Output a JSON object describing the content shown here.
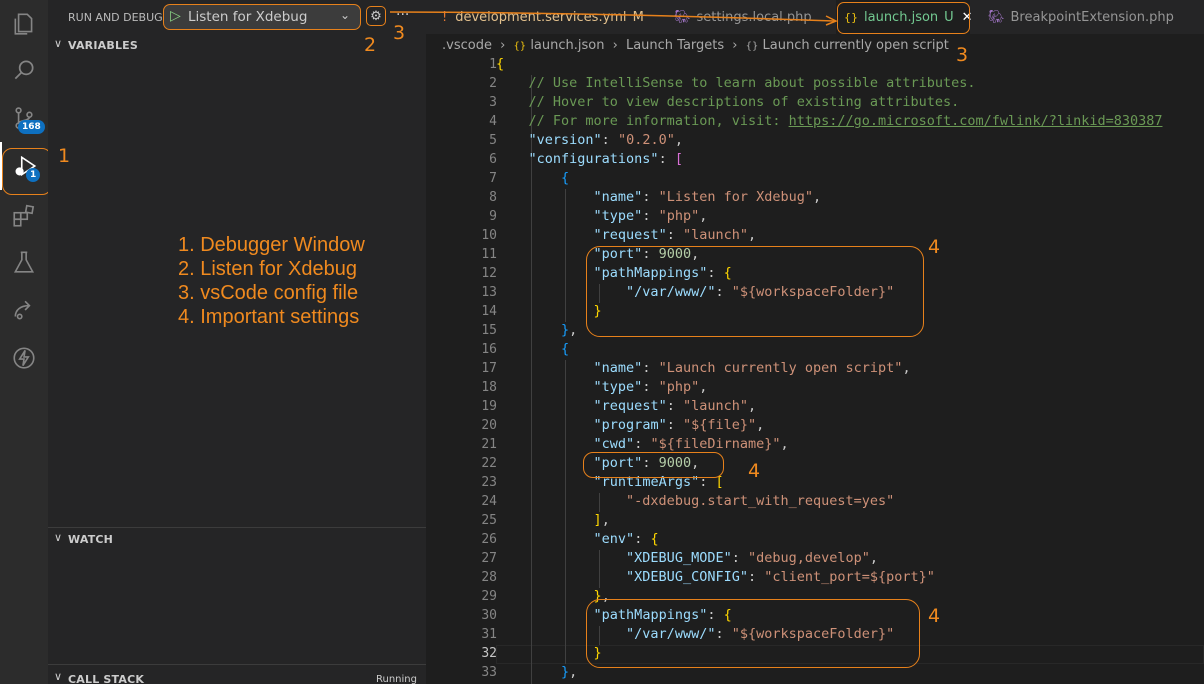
{
  "activity_bar": {
    "items": [
      {
        "name": "explorer-icon"
      },
      {
        "name": "search-icon"
      },
      {
        "name": "source-control-icon",
        "badge": "168"
      },
      {
        "name": "run-debug-icon",
        "badge": "1"
      },
      {
        "name": "extensions-icon"
      },
      {
        "name": "testing-icon"
      },
      {
        "name": "remote-explorer-icon"
      },
      {
        "name": "lightning-icon"
      }
    ]
  },
  "sidebar": {
    "title": "RUN AND DEBUG",
    "config_selected": "Listen for Xdebug",
    "sections": {
      "variables": "VARIABLES",
      "watch": "WATCH",
      "call_stack": "CALL STACK",
      "call_stack_status": "Running"
    },
    "legend": [
      "1. Debugger Window",
      "2. Listen for Xdebug",
      "3. vsCode config file",
      "4. Important settings"
    ]
  },
  "tabs": [
    {
      "label": "development.services.yml",
      "suffix": "M",
      "icon": "!"
    },
    {
      "label": "settings.local.php",
      "suffix": ""
    },
    {
      "label": "launch.json",
      "suffix": "U",
      "icon": "{}",
      "active": true
    },
    {
      "label": "BreakpointExtension.php",
      "suffix": ""
    }
  ],
  "breadcrumb": [
    ".vscode",
    "launch.json",
    "Launch Targets",
    "Launch currently open script"
  ],
  "annotations": {
    "a1": "1",
    "a2": "2",
    "a3": "3",
    "a3b": "3",
    "a4a": "4",
    "a4b": "4",
    "a4c": "4"
  },
  "code_lines": [
    {
      "n": "1",
      "t": "{"
    },
    {
      "n": "2",
      "t": "    // Use IntelliSense to learn about possible attributes."
    },
    {
      "n": "3",
      "t": "    // Hover to view descriptions of existing attributes."
    },
    {
      "n": "4",
      "t": "    // For more information, visit: https://go.microsoft.com/fwlink/?linkid=830387"
    },
    {
      "n": "5",
      "t": "    \"version\": \"0.2.0\","
    },
    {
      "n": "6",
      "t": "    \"configurations\": ["
    },
    {
      "n": "7",
      "t": "        {"
    },
    {
      "n": "8",
      "t": "            \"name\": \"Listen for Xdebug\","
    },
    {
      "n": "9",
      "t": "            \"type\": \"php\","
    },
    {
      "n": "10",
      "t": "            \"request\": \"launch\","
    },
    {
      "n": "11",
      "t": "            \"port\": 9000,"
    },
    {
      "n": "12",
      "t": "            \"pathMappings\": {"
    },
    {
      "n": "13",
      "t": "                \"/var/www/\": \"${workspaceFolder}\""
    },
    {
      "n": "14",
      "t": "            }"
    },
    {
      "n": "15",
      "t": "        },"
    },
    {
      "n": "16",
      "t": "        {"
    },
    {
      "n": "17",
      "t": "            \"name\": \"Launch currently open script\","
    },
    {
      "n": "18",
      "t": "            \"type\": \"php\","
    },
    {
      "n": "19",
      "t": "            \"request\": \"launch\","
    },
    {
      "n": "20",
      "t": "            \"program\": \"${file}\","
    },
    {
      "n": "21",
      "t": "            \"cwd\": \"${fileDirname}\","
    },
    {
      "n": "22",
      "t": "            \"port\": 9000,"
    },
    {
      "n": "23",
      "t": "            \"runtimeArgs\": ["
    },
    {
      "n": "24",
      "t": "                \"-dxdebug.start_with_request=yes\""
    },
    {
      "n": "25",
      "t": "            ],"
    },
    {
      "n": "26",
      "t": "            \"env\": {"
    },
    {
      "n": "27",
      "t": "                \"XDEBUG_MODE\": \"debug,develop\","
    },
    {
      "n": "28",
      "t": "                \"XDEBUG_CONFIG\": \"client_port=${port}\""
    },
    {
      "n": "29",
      "t": "            },"
    },
    {
      "n": "30",
      "t": "            \"pathMappings\": {"
    },
    {
      "n": "31",
      "t": "                \"/var/www/\": \"${workspaceFolder}\""
    },
    {
      "n": "32",
      "t": "            }"
    },
    {
      "n": "33",
      "t": "        },"
    }
  ]
}
